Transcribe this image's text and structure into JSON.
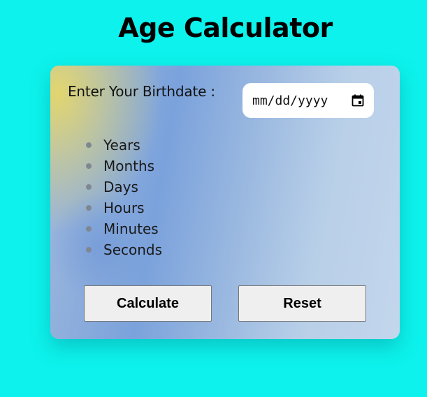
{
  "page": {
    "title": "Age Calculator",
    "background_color": "#0df2ec"
  },
  "form": {
    "birthdate_label": "Enter Your Birthdate :",
    "date_placeholder": "mm/dd/yyyy",
    "calendar_icon": "calendar-icon"
  },
  "results": {
    "units": [
      "Years",
      "Months",
      "Days",
      "Hours",
      "Minutes",
      "Seconds"
    ]
  },
  "actions": {
    "calculate_label": "Calculate",
    "reset_label": "Reset"
  }
}
